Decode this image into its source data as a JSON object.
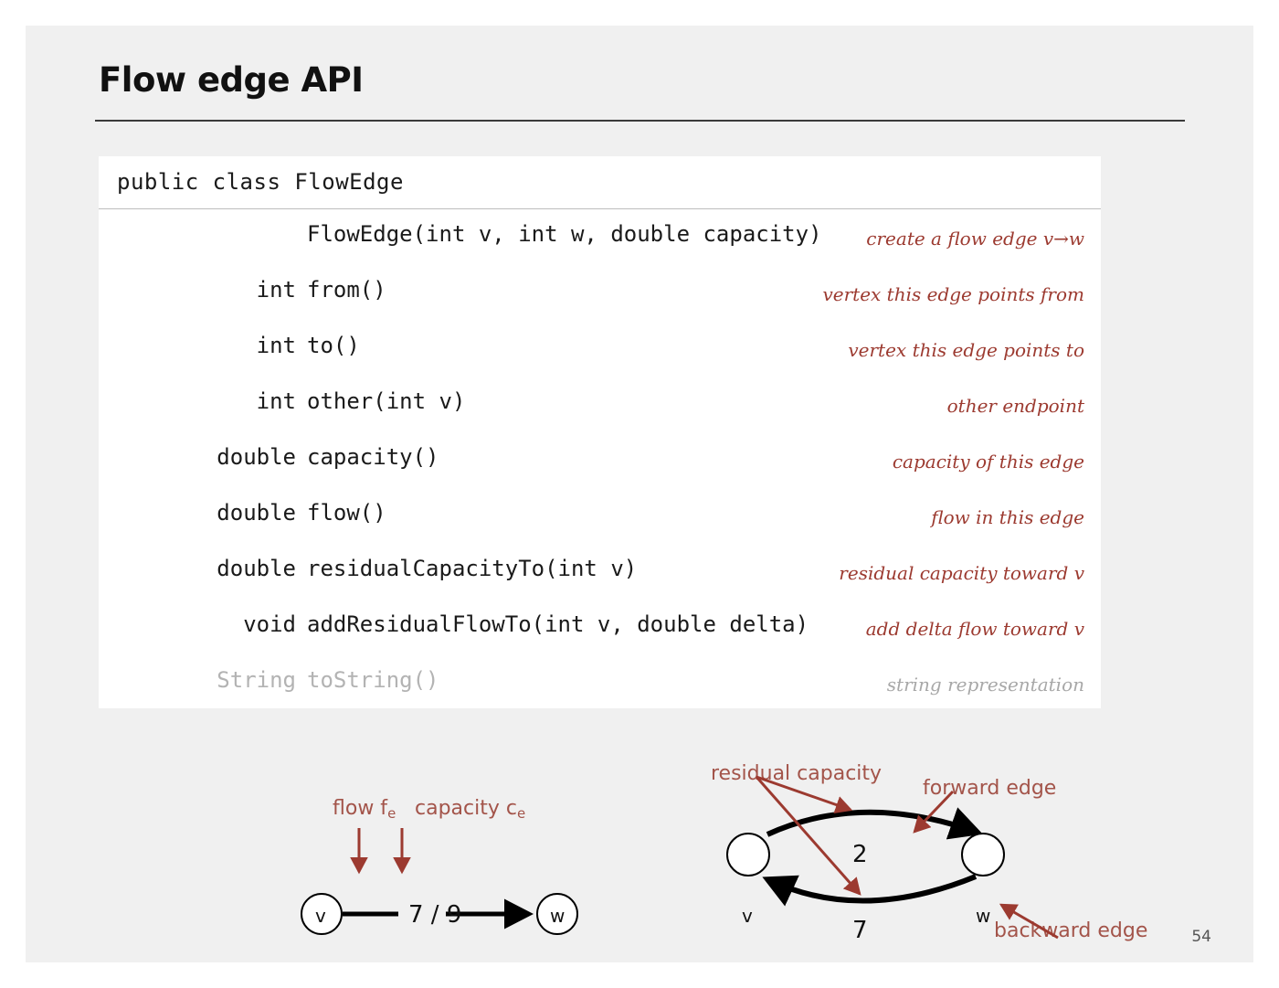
{
  "slide": {
    "title": "Flow edge API",
    "page_number": "54",
    "background_color": "#f0f0f0",
    "accent_color": "#9c3a30",
    "annotation_color": "#a3544a"
  },
  "api": {
    "class_declaration": "public class FlowEdge",
    "rows": [
      {
        "return_type": "",
        "signature": "FlowEdge(int v, int w, double capacity)",
        "description": "create a flow edge v→w",
        "dimmed": false
      },
      {
        "return_type": "int",
        "signature": "from()",
        "description": "vertex this edge points from",
        "dimmed": false
      },
      {
        "return_type": "int",
        "signature": "to()",
        "description": "vertex this edge points to",
        "dimmed": false
      },
      {
        "return_type": "int",
        "signature": "other(int v)",
        "description": "other endpoint",
        "dimmed": false
      },
      {
        "return_type": "double",
        "signature": "capacity()",
        "description": "capacity of this edge",
        "dimmed": false
      },
      {
        "return_type": "double",
        "signature": "flow()",
        "description": "flow in this edge",
        "dimmed": false
      },
      {
        "return_type": "double",
        "signature": "residualCapacityTo(int v)",
        "description": "residual capacity toward v",
        "dimmed": false
      },
      {
        "return_type": "void",
        "signature": "addResidualFlowTo(int v, double delta)",
        "description": "add delta flow toward v",
        "dimmed": false
      },
      {
        "return_type": "String",
        "signature": "toString()",
        "description": "string representation",
        "dimmed": true
      }
    ]
  },
  "figures": {
    "left": {
      "flow_label": "flow f",
      "flow_label_sub": "e",
      "capacity_label": "capacity c",
      "capacity_label_sub": "e",
      "edge_value": "7 / 9",
      "from_vertex": "v",
      "to_vertex": "w"
    },
    "right": {
      "residual_capacity_label": "residual capacity",
      "forward_edge_label": "forward edge",
      "backward_edge_label": "backward edge",
      "forward_value": "2",
      "backward_value": "7",
      "from_vertex": "v",
      "to_vertex": "w"
    }
  }
}
